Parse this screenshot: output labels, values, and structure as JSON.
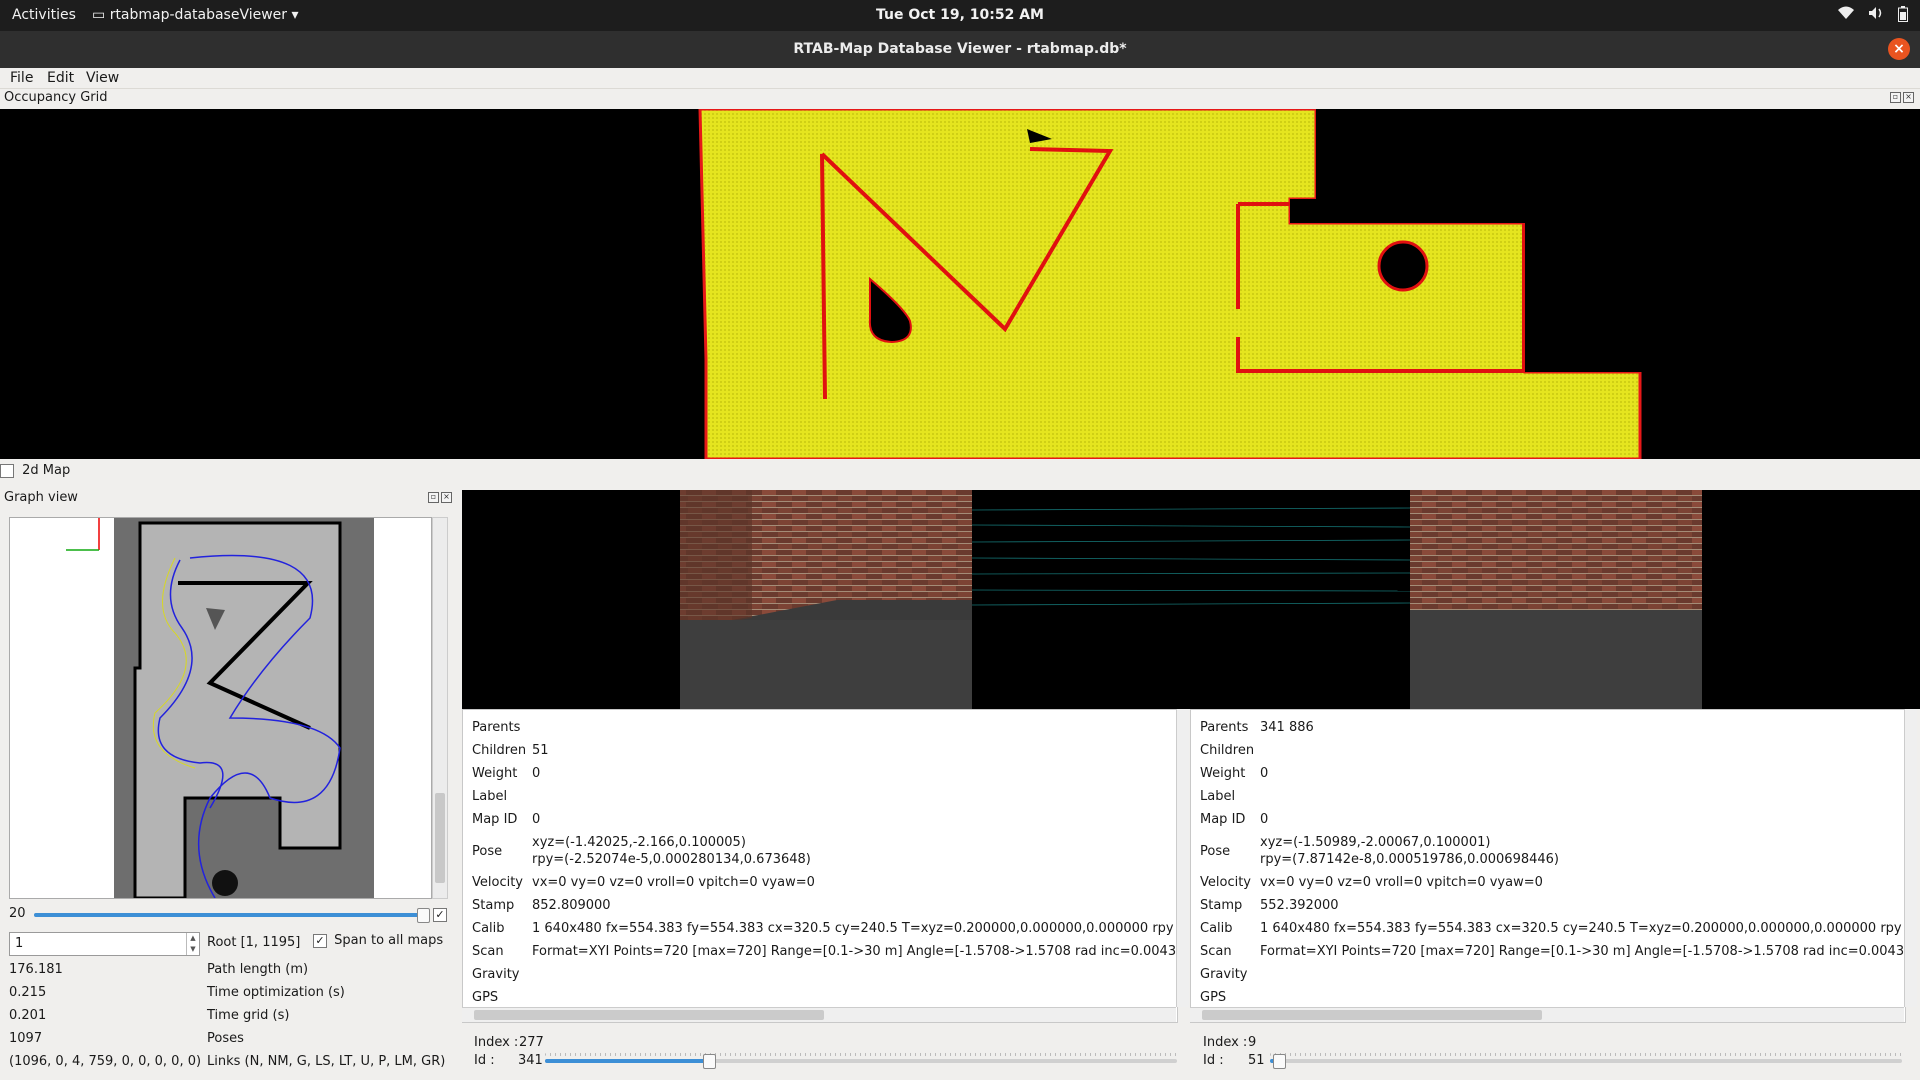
{
  "topbar": {
    "activities": "Activities",
    "app_menu": "rtabmap-databaseViewer",
    "clock": "Tue Oct 19, 10:52 AM"
  },
  "window": {
    "title": "RTAB-Map Database Viewer - rtabmap.db*",
    "close_glyph": "×"
  },
  "menu": {
    "file": "File",
    "edit": "Edit",
    "view": "View"
  },
  "occupancy": {
    "title": "Occupancy Grid"
  },
  "map2d": {
    "label": "2d Map",
    "checked": false
  },
  "graph": {
    "title": "Graph view",
    "slider_value": "20",
    "spin_value": "1",
    "root_label": "Root [1, 1195]",
    "span_label": "Span to all maps",
    "span_checked": true,
    "stats": [
      {
        "value": "176.181",
        "label": "Path length (m)"
      },
      {
        "value": "0.215",
        "label": "Time optimization (s)"
      },
      {
        "value": "0.201",
        "label": "Time grid (s)"
      },
      {
        "value": "1097",
        "label": "Poses"
      },
      {
        "value": "(1096, 0, 4, 759, 0, 0, 0, 0, 0)",
        "label": "Links (N, NM, G, LS, LT, U, P, LM, GR)"
      }
    ]
  },
  "left_node": {
    "fields": [
      {
        "key": "Parents",
        "value": ""
      },
      {
        "key": "Children",
        "value": "51"
      },
      {
        "key": "Weight",
        "value": "0"
      },
      {
        "key": "Label",
        "value": ""
      },
      {
        "key": "Map ID",
        "value": "0"
      },
      {
        "key": "Pose",
        "value": "xyz=(-1.42025,-2.166,0.100005)",
        "value2": "rpy=(-2.52074e-5,0.000280134,0.673648)"
      },
      {
        "key": "Velocity",
        "value": "vx=0 vy=0 vz=0 vroll=0 vpitch=0 vyaw=0"
      },
      {
        "key": "Stamp",
        "value": "852.809000"
      },
      {
        "key": "Calib",
        "value": "1 640x480 fx=554.383 fy=554.383 cx=320.5 cy=240.5 T=xyz=0.200000,0.000000,0.000000 rpy"
      },
      {
        "key": "Scan",
        "value": "Format=XYI Points=720 [max=720] Range=[0.1->30 m] Angle=[-1.5708->1.5708 rad inc=0.0043"
      },
      {
        "key": "Gravity",
        "value": ""
      },
      {
        "key": "GPS",
        "value": ""
      }
    ],
    "index_label": "Index :",
    "index_value": "277",
    "id_label": "Id :",
    "id_value": "341",
    "slider_fraction": 0.255
  },
  "right_node": {
    "fields": [
      {
        "key": "Parents",
        "value": "341 886"
      },
      {
        "key": "Children",
        "value": ""
      },
      {
        "key": "Weight",
        "value": "0"
      },
      {
        "key": "Label",
        "value": ""
      },
      {
        "key": "Map ID",
        "value": "0"
      },
      {
        "key": "Pose",
        "value": "xyz=(-1.50989,-2.00067,0.100001)",
        "value2": "rpy=(7.87142e-8,0.000519786,0.000698446)"
      },
      {
        "key": "Velocity",
        "value": "vx=0 vy=0 vz=0 vroll=0 vpitch=0 vyaw=0"
      },
      {
        "key": "Stamp",
        "value": "552.392000"
      },
      {
        "key": "Calib",
        "value": "1 640x480 fx=554.383 fy=554.383 cx=320.5 cy=240.5 T=xyz=0.200000,0.000000,0.000000 rpy"
      },
      {
        "key": "Scan",
        "value": "Format=XYI Points=720 [max=720] Range=[0.1->30 m] Angle=[-1.5708->1.5708 rad inc=0.0043"
      },
      {
        "key": "Gravity",
        "value": ""
      },
      {
        "key": "GPS",
        "value": ""
      }
    ],
    "index_label": "Index :",
    "index_value": "9",
    "id_label": "Id :",
    "id_value": "51",
    "slider_fraction": 0.005
  },
  "colors": {
    "occupied_free": "#e8e826",
    "obstacle": "#e01010",
    "slider_accent": "#3d8fd6",
    "ubuntu_orange": "#e95420"
  },
  "icons": [
    "wifi-icon",
    "volume-icon",
    "battery-icon",
    "window-icon",
    "chevron-down-icon",
    "float-icon",
    "close-icon"
  ]
}
